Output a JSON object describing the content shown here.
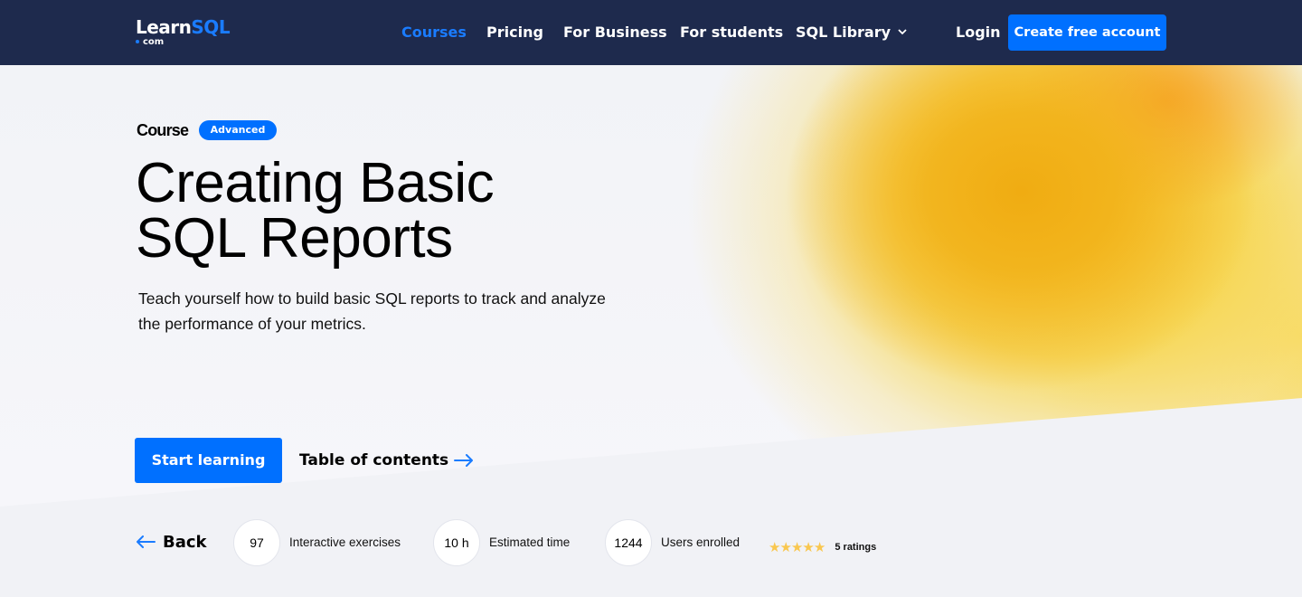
{
  "header": {
    "logo": {
      "main": "Learn",
      "accent": "SQL",
      "sub": "com"
    },
    "nav": [
      {
        "label": "Courses",
        "active": true
      },
      {
        "label": "Pricing",
        "active": false
      },
      {
        "label": "For Business",
        "active": false
      },
      {
        "label": "For students",
        "active": false
      },
      {
        "label": "SQL Library",
        "active": false,
        "dropdown": true
      }
    ],
    "login_label": "Login",
    "cta_label": "Create free account"
  },
  "hero": {
    "type_label": "Course",
    "level_badge": "Advanced",
    "title_line1": "Creating Basic",
    "title_line2": "SQL Reports",
    "description": "Teach yourself how to build basic SQL reports to track and analyze the performance of your metrics.",
    "start_button": "Start learning",
    "toc_link": "Table of contents"
  },
  "stats": {
    "back_label": "Back",
    "items": [
      {
        "value": "97",
        "label": "Interactive exercises"
      },
      {
        "value": "10 h",
        "label": "Estimated time"
      },
      {
        "value": "1244",
        "label": "Users enrolled"
      }
    ],
    "rating": {
      "stars": 5,
      "max_stars": 5,
      "label": "5 ratings"
    }
  },
  "colors": {
    "header_bg": "#1e2a4d",
    "accent_blue": "#0070ff",
    "link_blue": "#1a7cff",
    "star_yellow": "#f9c74f",
    "page_bg": "#f1f2f6"
  }
}
